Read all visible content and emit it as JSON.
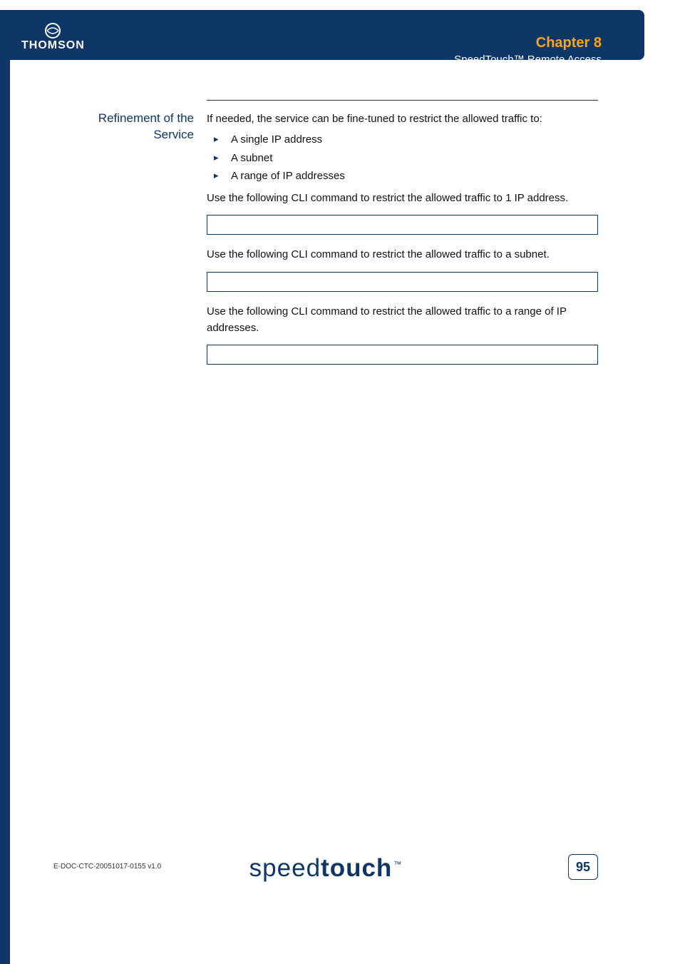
{
  "header": {
    "logo_text": "THOMSON",
    "chapter": "Chapter 8",
    "subtitle": "SpeedTouch™ Remote Access"
  },
  "section": {
    "label": "Refinement of the Service",
    "intro": "If needed, the service can be fine-tuned to restrict the allowed traffic to:",
    "bullets": [
      "A single IP address",
      "A subnet",
      "A range of IP addresses"
    ],
    "line1": "Use the following CLI command to restrict the allowed traffic to 1 IP address.",
    "line2": "Use the following CLI command to restrict the allowed traffic to a subnet.",
    "line3": "Use the following CLI command to restrict the allowed traffic to a range of IP addresses."
  },
  "footer": {
    "edoc": "E-DOC-CTC-20051017-0155 v1.0",
    "brand_light": "speed",
    "brand_bold": "touch",
    "tm": "™",
    "page": "95"
  }
}
